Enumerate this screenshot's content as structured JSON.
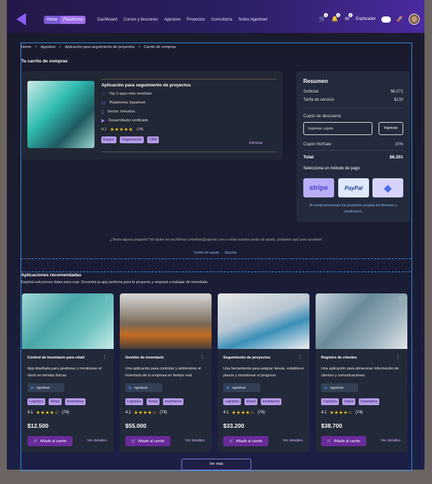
{
  "nav": {
    "home": "Home",
    "platform": "Plataforma",
    "links": [
      "Dashboard",
      "Cursos y lecciones",
      "Appstore",
      "Proyectos",
      "Consultoría",
      "Sobre Appsheet"
    ],
    "badges": [
      "1",
      "2",
      "3"
    ],
    "explorer": "Explorador"
  },
  "breadcrumb": [
    "Home",
    "/",
    "Appstore",
    "/",
    "Aplicación para seguimiento de proyectos",
    "/",
    "Carrito de compras"
  ],
  "cart": {
    "title": "Tu carrito de compras",
    "item": {
      "name": "Aplicación para seguimiento de proyectos",
      "top": "Top 3 apps más vendidas",
      "platform": "Plataforma: Appsheet",
      "sector": "Sector: Industria",
      "dev": "Desarrollador verificado",
      "rating": "4.1",
      "reviews": "(74)",
      "tags": [
        "Equipo",
        "Organización",
        "CRM"
      ],
      "remove": "Eliminar"
    }
  },
  "summary": {
    "title": "Resumen",
    "subtotal_label": "Subtotal",
    "subtotal": "$6.071",
    "fee_label": "Tarifa de servicio",
    "fee": "$130",
    "coupon_label": "Cupón de descuento",
    "coupon_placeholder": "Ingresar cupón",
    "coupon_button": "Ingresar",
    "hotsale_label": "Cupón HotSale",
    "hotsale": "20%",
    "total_label": "Total",
    "total": "$6.201",
    "pay_label": "Selecciona un método de pago",
    "pay_methods": [
      "stripe",
      "PayPal",
      "Ethereum"
    ],
    "terms": "Al comprar/contratar los productos aceptas los términos y condiciones."
  },
  "help": {
    "text": "¿Tenés alguna pregunta? No dudes en escribirnos a kiwihub@soporte.com o visitar nuestro centro de ayuda. ¡Estamos aquí para ayudarte!",
    "links": [
      "Centro de ayuda",
      "Soporte"
    ]
  },
  "recommended": {
    "title": "Aplicaciones recomendadas",
    "subtitle": "Explorá soluciones listas para usar. Encontrá la app perfecta para tu proyecto y empezá a trabajar de inmediato.",
    "add_label": "Añadir al carrito",
    "details_label": "Ver detalles",
    "appsheet": "AppSheet",
    "items": [
      {
        "name": "Control de Inventario para retail",
        "desc": "App diseñada para gestionar y monitorear el stock en tiendas físicas",
        "tags": [
          "Logística",
          "Retail",
          "Inventarios"
        ],
        "rating": "4.1",
        "reviews": "(74)",
        "price": "$12.500"
      },
      {
        "name": "Gestión de inventario",
        "desc": "Una aplicación para controlar y administrar el inventario de tu empresa en tiempo real.",
        "tags": [
          "Logística",
          "Retail",
          "Inventarios"
        ],
        "rating": "4.1",
        "reviews": "(74)",
        "price": "$55.000"
      },
      {
        "name": "Seguimiento de proyectos",
        "desc": "Una herramienta para asignar tareas, establecer plazos y monitorear el progreso",
        "tags": [
          "Logística",
          "Retail",
          "Inventarios"
        ],
        "rating": "4.1",
        "reviews": "(74)",
        "price": "$33.200"
      },
      {
        "name": "Registro de clientes",
        "desc": "Una aplicación para almacenar información de clientes y comunicaciones",
        "tags": [
          "Logística",
          "Retail",
          "Inventarios"
        ],
        "rating": "4.1",
        "reviews": "(74)",
        "price": "$38.700"
      }
    ],
    "more": "Ver más"
  },
  "colors": {
    "accent": "#6a2a9a",
    "border": "#3a8fe0",
    "star": "#f5c518"
  }
}
